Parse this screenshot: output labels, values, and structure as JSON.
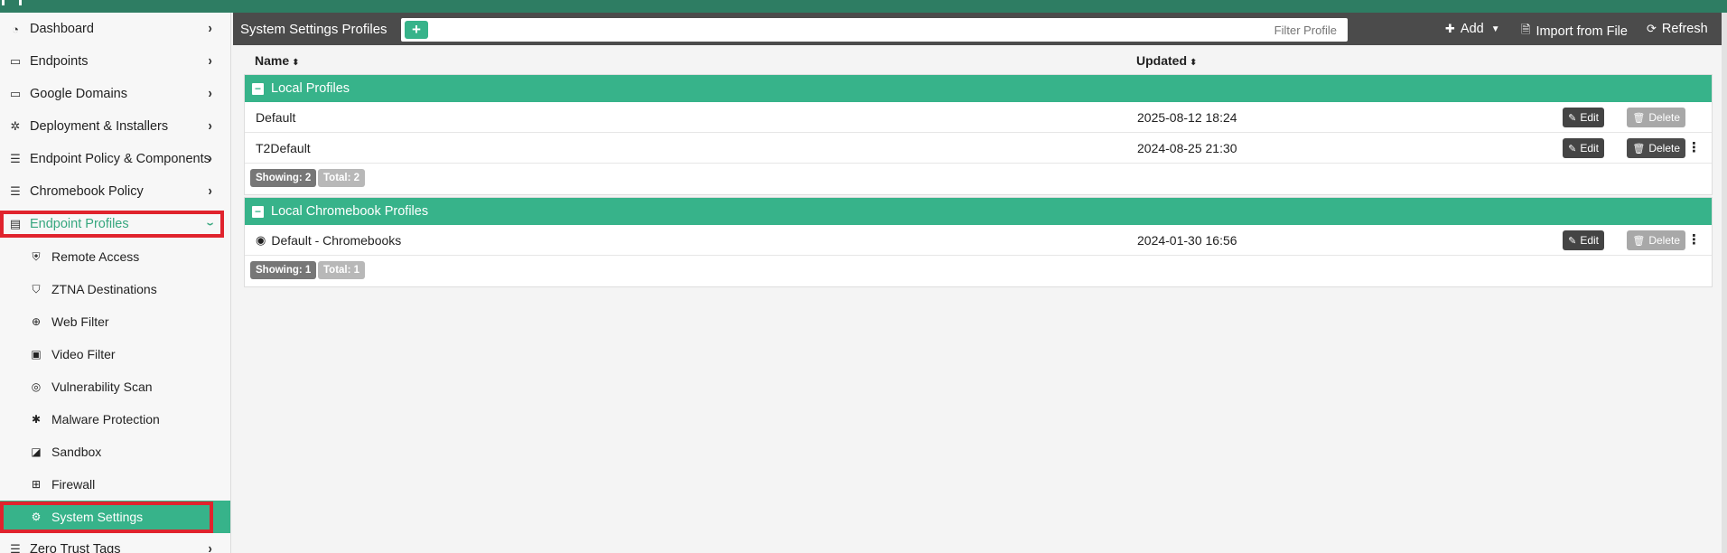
{
  "sidebar": {
    "items": [
      {
        "label": "Dashboard",
        "icon": "dashboard-icon"
      },
      {
        "label": "Endpoints",
        "icon": "endpoints-icon"
      },
      {
        "label": "Google Domains",
        "icon": "google-domains-icon"
      },
      {
        "label": "Deployment & Installers",
        "icon": "deployment-icon"
      },
      {
        "label": "Endpoint Policy & Components",
        "icon": "policy-icon"
      },
      {
        "label": "Chromebook Policy",
        "icon": "chromebook-policy-icon"
      },
      {
        "label": "Endpoint Profiles",
        "icon": "endpoint-profiles-icon"
      }
    ],
    "subitems": [
      {
        "label": "Remote Access",
        "icon": "shield-icon"
      },
      {
        "label": "ZTNA Destinations",
        "icon": "ztna-shield-icon"
      },
      {
        "label": "Web Filter",
        "icon": "web-filter-icon"
      },
      {
        "label": "Video Filter",
        "icon": "video-filter-icon"
      },
      {
        "label": "Vulnerability Scan",
        "icon": "vulnerability-icon"
      },
      {
        "label": "Malware Protection",
        "icon": "bug-icon"
      },
      {
        "label": "Sandbox",
        "icon": "sandbox-icon"
      },
      {
        "label": "Firewall",
        "icon": "firewall-icon"
      },
      {
        "label": "System Settings",
        "icon": "gear-icon"
      }
    ],
    "after": {
      "label": "Zero Trust Tags",
      "icon": "tags-icon"
    }
  },
  "header": {
    "title": "System Settings Profiles",
    "filter_placeholder": "Filter Profile",
    "add_label": "Add",
    "import_label": "Import from File",
    "refresh_label": "Refresh"
  },
  "columns": {
    "name": "Name",
    "updated": "Updated"
  },
  "groups": [
    {
      "title": "Local Profiles",
      "rows": [
        {
          "name": "Default",
          "updated": "2025-08-12 18:24",
          "delete_enabled": false
        },
        {
          "name": "T2Default",
          "updated": "2024-08-25 21:30",
          "delete_enabled": true
        }
      ],
      "showing": "Showing: 2",
      "total": "Total: 2"
    },
    {
      "title": "Local Chromebook Profiles",
      "rows": [
        {
          "name": "Default - Chromebooks",
          "updated": "2024-01-30 16:56",
          "delete_enabled": false
        }
      ],
      "showing": "Showing: 1",
      "total": "Total: 1"
    }
  ],
  "actions": {
    "edit_label": "Edit",
    "delete_label": "Delete"
  },
  "colors": {
    "accent": "#37b38a",
    "header": "#4b4b4b",
    "highlight": "#e0232d"
  }
}
